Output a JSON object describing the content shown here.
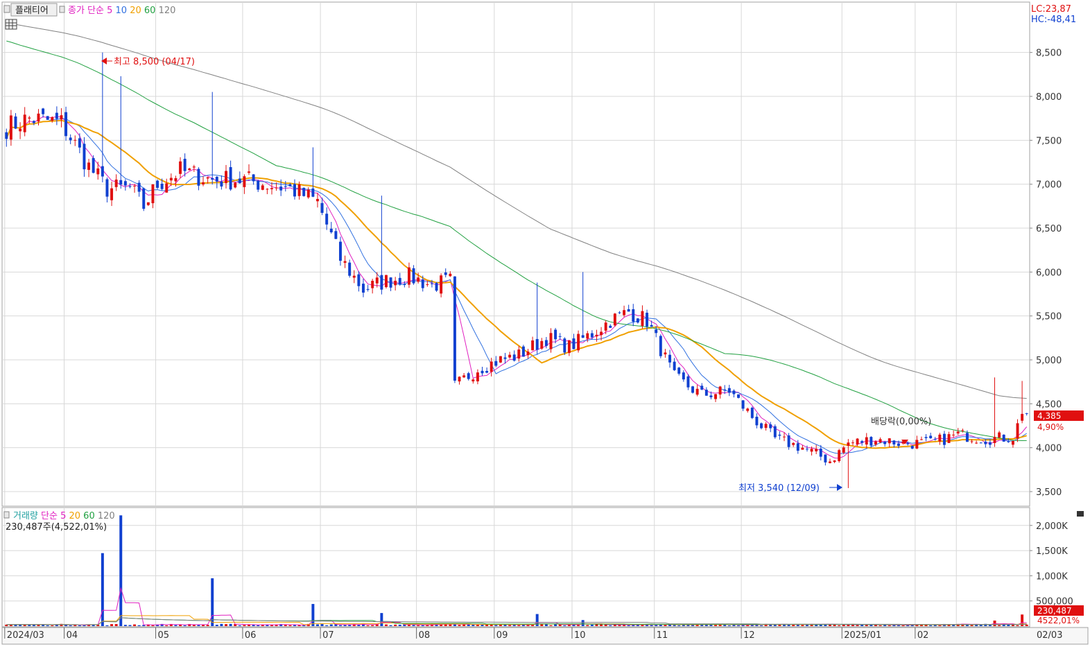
{
  "price_panel": {
    "tab_label": "플래티어",
    "legend": [
      {
        "text": "종가 단순 5",
        "color": "#e020c0"
      },
      {
        "text": "10",
        "color": "#3070e0"
      },
      {
        "text": "20",
        "color": "#f0a000"
      },
      {
        "text": "60",
        "color": "#20a040"
      },
      {
        "text": "120",
        "color": "#808080"
      }
    ],
    "lc_text": "LC:23,87",
    "hc_text": "HC:-48,41",
    "high_annotation": "최고 8,500 (04/17)",
    "low_annotation": "최저 3,540 (12/09)",
    "dividend_annotation": "배당락(0,00%)",
    "current_price_label": "4,385",
    "current_change_label": "4,90%"
  },
  "volume_panel": {
    "legend": [
      {
        "text": "거래량",
        "color": "#20a0a0"
      },
      {
        "text": "단순 5",
        "color": "#e020c0"
      },
      {
        "text": "20",
        "color": "#f0a000"
      },
      {
        "text": "60",
        "color": "#20a040"
      },
      {
        "text": "120",
        "color": "#808080"
      }
    ],
    "volume_text": "230,487주(4,522,01%)",
    "current_volume_label": "230,487",
    "current_volume_pct": "4522,01%"
  },
  "colors": {
    "up": "#e01010",
    "down": "#1040d0",
    "grid": "#d8d8d8",
    "ma5": "#e020c0",
    "ma10": "#3070e0",
    "ma20": "#f0a000",
    "ma60": "#20a040",
    "ma120": "#808080"
  },
  "chart_data": [
    {
      "type": "candlestick",
      "title": "",
      "y_ticks": [
        3500,
        4000,
        4500,
        5000,
        5500,
        6000,
        6500,
        7000,
        7500,
        8000,
        8500
      ],
      "y_tick_labels": [
        "3,500",
        "4,000",
        "4,500",
        "5,000",
        "5,500",
        "6,000",
        "6,500",
        "7,000",
        "7,500",
        "8,000",
        "8,500"
      ],
      "ylim": [
        3350,
        9050
      ],
      "x_labels": [
        "2024/03",
        "04",
        "05",
        "06",
        "07",
        "08",
        "09",
        "10",
        "11",
        "12",
        "2025/01",
        "02",
        "02/03"
      ],
      "ohlc_keypoints_close": [
        [
          0,
          7650
        ],
        [
          5,
          7750
        ],
        [
          12,
          7700
        ],
        [
          18,
          7200
        ],
        [
          22,
          6950
        ],
        [
          27,
          6950
        ],
        [
          30,
          6750
        ],
        [
          33,
          7000
        ],
        [
          38,
          7150
        ],
        [
          45,
          7050
        ],
        [
          52,
          7050
        ],
        [
          57,
          7000
        ],
        [
          62,
          6950
        ],
        [
          68,
          6800
        ],
        [
          73,
          6150
        ],
        [
          78,
          5800
        ],
        [
          83,
          5900
        ],
        [
          88,
          5950
        ],
        [
          93,
          5850
        ],
        [
          97,
          5900
        ],
        [
          98,
          4700
        ],
        [
          103,
          4900
        ],
        [
          108,
          5000
        ],
        [
          112,
          5050
        ],
        [
          118,
          5250
        ],
        [
          123,
          5150
        ],
        [
          128,
          5300
        ],
        [
          132,
          5450
        ],
        [
          136,
          5550
        ],
        [
          140,
          5450
        ],
        [
          146,
          4800
        ],
        [
          152,
          4600
        ],
        [
          158,
          4650
        ],
        [
          163,
          4350
        ],
        [
          168,
          4100
        ],
        [
          174,
          4000
        ],
        [
          180,
          3850
        ],
        [
          184,
          4050
        ],
        [
          190,
          4100
        ],
        [
          196,
          4050
        ],
        [
          202,
          4050
        ],
        [
          208,
          4150
        ],
        [
          214,
          4100
        ],
        [
          220,
          4120
        ],
        [
          222,
          4385
        ]
      ],
      "high": {
        "value": 8500,
        "date": "04/17"
      },
      "low": {
        "value": 3540,
        "date": "12/09"
      },
      "moving_averages": [
        {
          "name": "5",
          "window": 5
        },
        {
          "name": "10",
          "window": 10
        },
        {
          "name": "20",
          "window": 20
        },
        {
          "name": "60",
          "window": 60
        },
        {
          "name": "120",
          "window": 120
        }
      ],
      "ma60_start": 8650,
      "ma120_start": 8850,
      "last_close": 4385,
      "last_change_pct": 4.9
    },
    {
      "type": "bar",
      "title": "",
      "y_ticks": [
        500000,
        1000000,
        1500000,
        2000000
      ],
      "y_tick_labels": [
        "500,000",
        "1,000K",
        "1,500K",
        "2,000K"
      ],
      "ylim": [
        0,
        2300000
      ],
      "spikes": [
        [
          21,
          1450000
        ],
        [
          25,
          2200000
        ],
        [
          45,
          950000
        ],
        [
          67,
          440000
        ],
        [
          82,
          260000
        ],
        [
          116,
          240000
        ],
        [
          126,
          120000
        ],
        [
          216,
          110000
        ],
        [
          222,
          230487
        ]
      ],
      "base_volume": 30000,
      "last_volume": 230487
    }
  ]
}
